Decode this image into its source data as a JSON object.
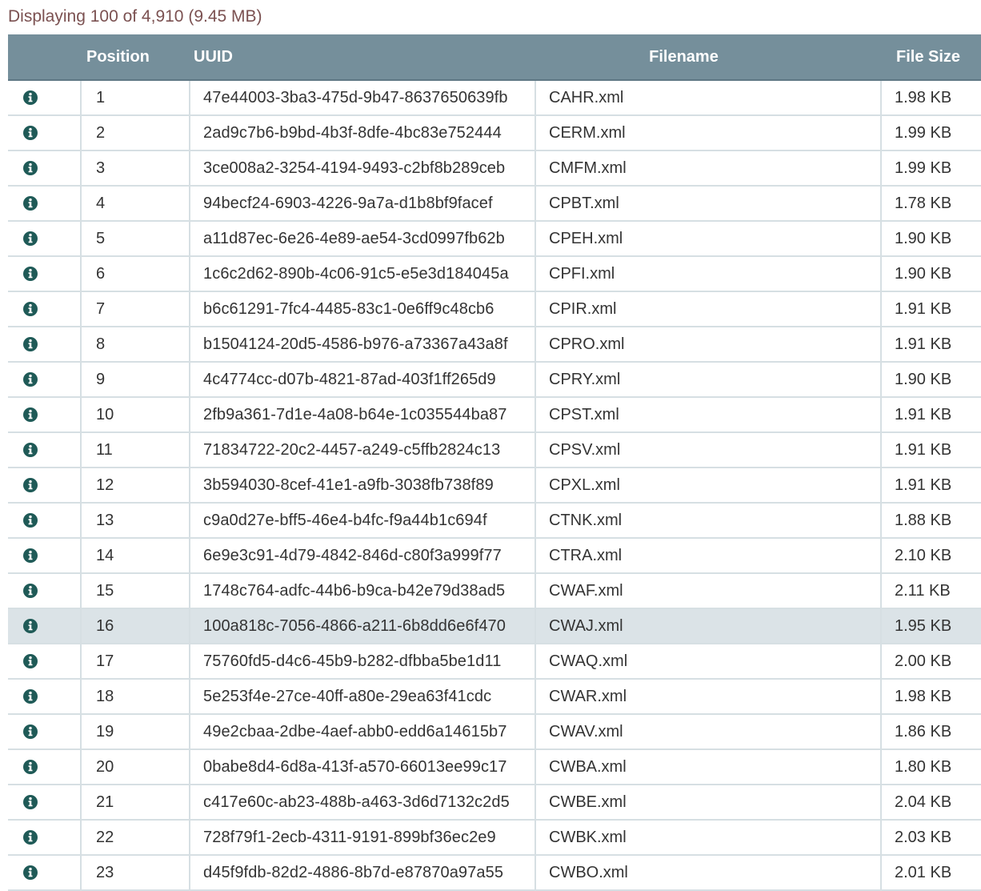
{
  "summary": "Displaying 100 of 4,910 (9.45 MB)",
  "columns": {
    "info": "",
    "position": "Position",
    "uuid": "UUID",
    "filename": "Filename",
    "size": "File Size"
  },
  "colors": {
    "header_bg": "#758f9b",
    "summary_text": "#7b5151",
    "icon": "#1f5a57",
    "row_highlight": "#dbe3e7"
  },
  "icon": "info-circle-icon",
  "highlighted_row": 16,
  "rows": [
    {
      "position": "1",
      "uuid": "47e44003-3ba3-475d-9b47-8637650639fb",
      "filename": "CAHR.xml",
      "size": "1.98 KB"
    },
    {
      "position": "2",
      "uuid": "2ad9c7b6-b9bd-4b3f-8dfe-4bc83e752444",
      "filename": "CERM.xml",
      "size": "1.99 KB"
    },
    {
      "position": "3",
      "uuid": "3ce008a2-3254-4194-9493-c2bf8b289ceb",
      "filename": "CMFM.xml",
      "size": "1.99 KB"
    },
    {
      "position": "4",
      "uuid": "94becf24-6903-4226-9a7a-d1b8bf9facef",
      "filename": "CPBT.xml",
      "size": "1.78 KB"
    },
    {
      "position": "5",
      "uuid": "a11d87ec-6e26-4e89-ae54-3cd0997fb62b",
      "filename": "CPEH.xml",
      "size": "1.90 KB"
    },
    {
      "position": "6",
      "uuid": "1c6c2d62-890b-4c06-91c5-e5e3d184045a",
      "filename": "CPFI.xml",
      "size": "1.90 KB"
    },
    {
      "position": "7",
      "uuid": "b6c61291-7fc4-4485-83c1-0e6ff9c48cb6",
      "filename": "CPIR.xml",
      "size": "1.91 KB"
    },
    {
      "position": "8",
      "uuid": "b1504124-20d5-4586-b976-a73367a43a8f",
      "filename": "CPRO.xml",
      "size": "1.91 KB"
    },
    {
      "position": "9",
      "uuid": "4c4774cc-d07b-4821-87ad-403f1ff265d9",
      "filename": "CPRY.xml",
      "size": "1.90 KB"
    },
    {
      "position": "10",
      "uuid": "2fb9a361-7d1e-4a08-b64e-1c035544ba87",
      "filename": "CPST.xml",
      "size": "1.91 KB"
    },
    {
      "position": "11",
      "uuid": "71834722-20c2-4457-a249-c5ffb2824c13",
      "filename": "CPSV.xml",
      "size": "1.91 KB"
    },
    {
      "position": "12",
      "uuid": "3b594030-8cef-41e1-a9fb-3038fb738f89",
      "filename": "CPXL.xml",
      "size": "1.91 KB"
    },
    {
      "position": "13",
      "uuid": "c9a0d27e-bff5-46e4-b4fc-f9a44b1c694f",
      "filename": "CTNK.xml",
      "size": "1.88 KB"
    },
    {
      "position": "14",
      "uuid": "6e9e3c91-4d79-4842-846d-c80f3a999f77",
      "filename": "CTRA.xml",
      "size": "2.10 KB"
    },
    {
      "position": "15",
      "uuid": "1748c764-adfc-44b6-b9ca-b42e79d38ad5",
      "filename": "CWAF.xml",
      "size": "2.11 KB"
    },
    {
      "position": "16",
      "uuid": "100a818c-7056-4866-a211-6b8dd6e6f470",
      "filename": "CWAJ.xml",
      "size": "1.95 KB"
    },
    {
      "position": "17",
      "uuid": "75760fd5-d4c6-45b9-b282-dfbba5be1d11",
      "filename": "CWAQ.xml",
      "size": "2.00 KB"
    },
    {
      "position": "18",
      "uuid": "5e253f4e-27ce-40ff-a80e-29ea63f41cdc",
      "filename": "CWAR.xml",
      "size": "1.98 KB"
    },
    {
      "position": "19",
      "uuid": "49e2cbaa-2dbe-4aef-abb0-edd6a14615b7",
      "filename": "CWAV.xml",
      "size": "1.86 KB"
    },
    {
      "position": "20",
      "uuid": "0babe8d4-6d8a-413f-a570-66013ee99c17",
      "filename": "CWBA.xml",
      "size": "1.80 KB"
    },
    {
      "position": "21",
      "uuid": "c417e60c-ab23-488b-a463-3d6d7132c2d5",
      "filename": "CWBE.xml",
      "size": "2.04 KB"
    },
    {
      "position": "22",
      "uuid": "728f79f1-2ecb-4311-9191-899bf36ec2e9",
      "filename": "CWBK.xml",
      "size": "2.03 KB"
    },
    {
      "position": "23",
      "uuid": "d45f9fdb-82d2-4886-8b7d-e87870a97a55",
      "filename": "CWBO.xml",
      "size": "2.01 KB"
    }
  ]
}
